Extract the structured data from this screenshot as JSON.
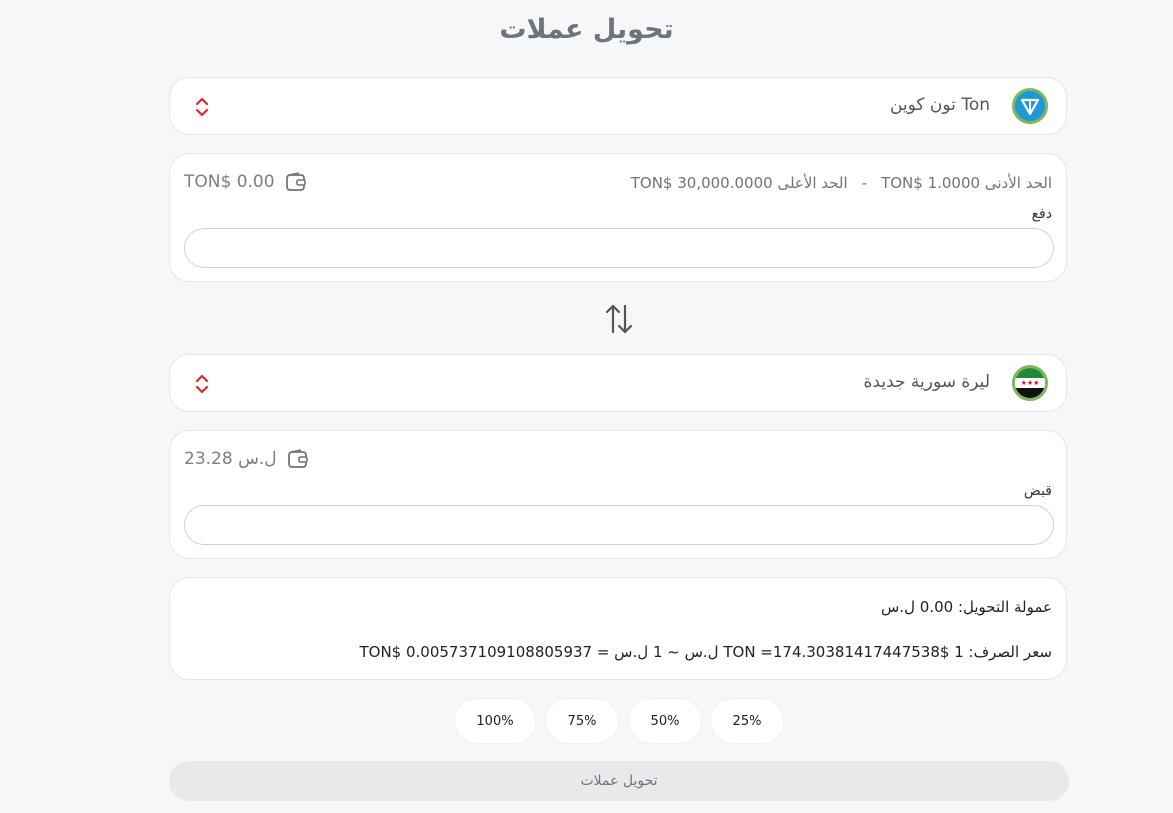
{
  "page": {
    "title": "تحويل عملات"
  },
  "from": {
    "coin_name": "Ton تون كوين",
    "logo_icon": "ton-icon",
    "balance": "TON$ 0.00",
    "min_limit": "الحد الأدنى TON$ 1.0000",
    "separator": "-",
    "max_limit": "الحد الأعلى TON$ 30,000.0000",
    "field_label": "دفع",
    "value": ""
  },
  "to": {
    "coin_name": "ليرة سورية جديدة",
    "logo_icon": "syria-flag-icon",
    "balance": "23.28 ل.س",
    "field_label": "قبض",
    "value": ""
  },
  "info": {
    "fee": "عمولة التحويل: 0.00 ل.س",
    "rate": "سعر الصرف: 1 $TON =174.30381417447538 ل.س ~ 1 ل.س = 0.005737109108805937 $TON"
  },
  "percent_buttons": [
    "100%",
    "75%",
    "50%",
    "25%"
  ],
  "convert_button": "تحويل عملات",
  "colors": {
    "accent_red": "#e0262e",
    "ton_blue": "#1e98d6",
    "disabled_button": "#e7e9eb"
  }
}
